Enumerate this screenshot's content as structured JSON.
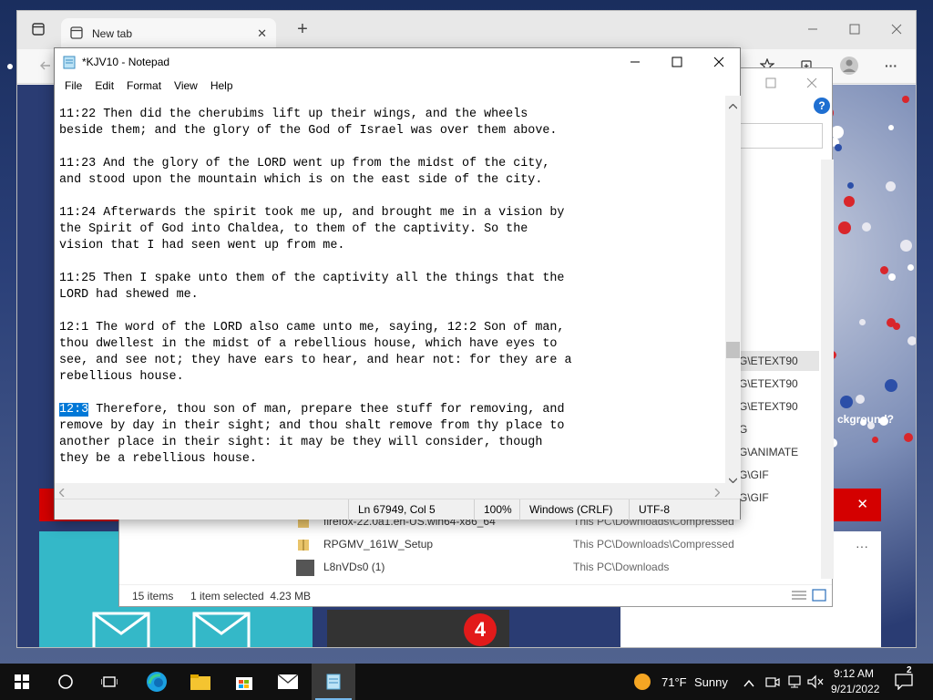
{
  "browser": {
    "tab_title": "New tab",
    "tab_close": "✕",
    "new_tab": "+",
    "more": "···"
  },
  "notepad": {
    "title": "*KJV10 - Notepad",
    "menu": [
      "File",
      "Edit",
      "Format",
      "View",
      "Help"
    ],
    "lines": [
      {
        "t": "11:22 Then did the cherubims lift up their wings, and the wheels"
      },
      {
        "t": "beside them; and the glory of the God of Israel was over them above."
      },
      {
        "t": ""
      },
      {
        "t": "11:23 And the glory of the LORD went up from the midst of the city,"
      },
      {
        "t": "and stood upon the mountain which is on the east side of the city."
      },
      {
        "t": ""
      },
      {
        "t": "11:24 Afterwards the spirit took me up, and brought me in a vision by"
      },
      {
        "t": "the Spirit of God into Chaldea, to them of the captivity. So the"
      },
      {
        "t": "vision that I had seen went up from me."
      },
      {
        "t": ""
      },
      {
        "t": "11:25 Then I spake unto them of the captivity all the things that the"
      },
      {
        "t": "LORD had shewed me."
      },
      {
        "t": ""
      },
      {
        "t": "12:1 The word of the LORD also came unto me, saying, 12:2 Son of man,"
      },
      {
        "t": "thou dwellest in the midst of a rebellious house, which have eyes to"
      },
      {
        "t": "see, and see not; they have ears to hear, and hear not: for they are a"
      },
      {
        "t": "rebellious house."
      },
      {
        "t": ""
      },
      {
        "sel": "12:3",
        "t": " Therefore, thou son of man, prepare thee stuff for removing, and"
      },
      {
        "t": "remove by day in their sight; and thou shalt remove from thy place to"
      },
      {
        "t": "another place in their sight: it may be they will consider, though"
      },
      {
        "t": "they be a rebellious house."
      }
    ],
    "status": {
      "position": "Ln 67949, Col 5",
      "zoom": "100%",
      "line_ending": "Windows (CRLF)",
      "encoding": "UTF-8"
    }
  },
  "explorer": {
    "paths": [
      "G\\ETEXT90",
      "G\\ETEXT90",
      "G\\ETEXT90",
      "G",
      "G\\ANIMATE",
      "G\\GIF",
      "G\\GIF"
    ],
    "files": [
      {
        "name": "firefox-22.0a1.en-US.win64-x86_64",
        "location": "This PC\\Downloads\\Compressed"
      },
      {
        "name": "RPGMV_161W_Setup",
        "location": "This PC\\Downloads\\Compressed"
      },
      {
        "name": "L8nVDs0 (1)",
        "location": "This PC\\Downloads"
      }
    ],
    "item_count": "15 items",
    "selection": "1 item selected  4.23 MB",
    "background_hint": "ckground?"
  },
  "taskbar": {
    "weather_temp": "71°F",
    "weather_cond": "Sunny",
    "time": "9:12 AM",
    "date": "9/21/2022",
    "notifications": "2",
    "badge": "4"
  },
  "colors": {
    "selection": "#0078d7",
    "taskbar": "#101010",
    "accent_red": "#d40000"
  }
}
